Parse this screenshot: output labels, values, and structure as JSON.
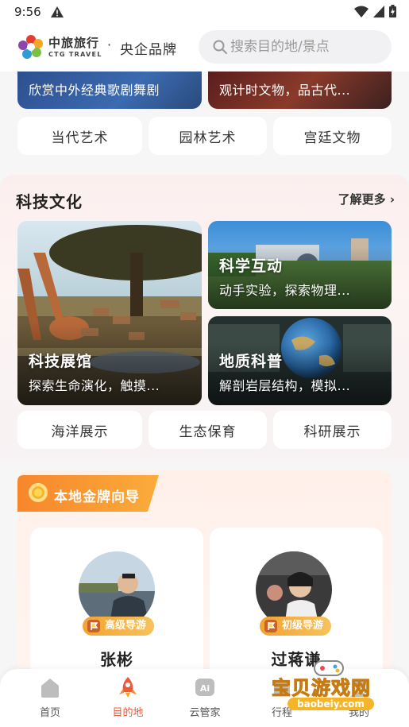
{
  "status_bar": {
    "time": "9:56"
  },
  "header": {
    "brand_cn": "中旅旅行",
    "brand_en": "CTG TRAVEL",
    "brand_dot": "·",
    "brand_sub": "央企品牌",
    "search_placeholder": "搜索目的地/景点"
  },
  "top_cards": [
    {
      "text": "欣赏中外经典歌剧舞剧"
    },
    {
      "text": "观计时文物，品古代..."
    }
  ],
  "art_tags": [
    "当代艺术",
    "园林艺术",
    "宫廷文物"
  ],
  "science": {
    "title": "科技文化",
    "more": "了解更多 ›",
    "cards": [
      {
        "title": "科技展馆",
        "desc": "探索生命演化，触摸..."
      },
      {
        "title": "科学互动",
        "desc": "动手实验，探索物理..."
      },
      {
        "title": "地质科普",
        "desc": "解剖岩层结构，模拟..."
      }
    ],
    "tags": [
      "海洋展示",
      "生态保育",
      "科研展示"
    ]
  },
  "guides": {
    "title": "本地金牌向导",
    "items": [
      {
        "name": "张彬",
        "level": "高级导游"
      },
      {
        "name": "过蒋谦",
        "level": "初级导游"
      }
    ]
  },
  "bottom_nav": [
    {
      "label": "首页",
      "icon": "home-icon"
    },
    {
      "label": "目的地",
      "icon": "rocket-icon",
      "active": true
    },
    {
      "label": "云管家",
      "icon": "ai-icon"
    },
    {
      "label": "行程",
      "icon": "trip-icon"
    },
    {
      "label": "我的",
      "icon": "profile-icon"
    }
  ],
  "watermark": {
    "text": "宝贝游戏网",
    "url": "baobeiy.com"
  },
  "colors": {
    "accent": "#ec5a3c",
    "gold": "#f4a233"
  }
}
